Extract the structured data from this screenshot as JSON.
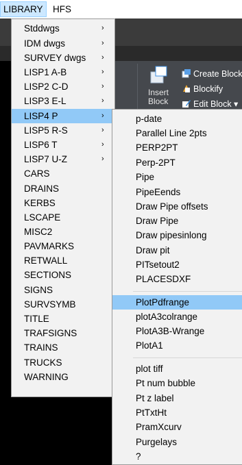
{
  "menubar": {
    "library": "LIBRARY",
    "hfs": "HFS"
  },
  "ribbon": {
    "insert_label_1": "Insert",
    "insert_label_2": "Block",
    "create_block": "Create Block",
    "blockify": "Blockify",
    "edit_block": "Edit Block ▾"
  },
  "library_menu": {
    "items": [
      {
        "label": "Stddwgs",
        "submenu": "›"
      },
      {
        "label": "IDM dwgs",
        "submenu": "›"
      },
      {
        "label": "SURVEY dwgs",
        "submenu": "›"
      },
      {
        "label": "LISP1 A-B",
        "submenu": "›"
      },
      {
        "label": "LISP2 C-D",
        "submenu": "›"
      },
      {
        "label": "LISP3 E-L",
        "submenu": "›"
      },
      {
        "label": "LISP4 P",
        "submenu": "›"
      },
      {
        "label": "LISP5 R-S",
        "submenu": "›"
      },
      {
        "label": "LISP6 T",
        "submenu": "›"
      },
      {
        "label": "LISP7 U-Z",
        "submenu": "›"
      },
      {
        "label": "CARS"
      },
      {
        "label": "DRAINS"
      },
      {
        "label": "KERBS"
      },
      {
        "label": "LSCAPE"
      },
      {
        "label": "MISC2"
      },
      {
        "label": "PAVMARKS"
      },
      {
        "label": "RETWALL"
      },
      {
        "label": "SECTIONS"
      },
      {
        "label": "SIGNS"
      },
      {
        "label": "SURVSYMB"
      },
      {
        "label": "TITLE"
      },
      {
        "label": "TRAFSIGNS"
      },
      {
        "label": "TRAINS"
      },
      {
        "label": "TRUCKS"
      },
      {
        "label": "WARNING"
      }
    ]
  },
  "lisp4_menu": {
    "items": [
      {
        "label": "p-date"
      },
      {
        "label": "Parallel Line 2pts"
      },
      {
        "label": "PERP2PT"
      },
      {
        "label": "Perp-2PT"
      },
      {
        "label": "Pipe"
      },
      {
        "label": "PipeEends"
      },
      {
        "label": "Draw Pipe offsets"
      },
      {
        "label": "Draw Pipe"
      },
      {
        "label": "Draw pipesinlong"
      },
      {
        "label": "Draw pit"
      },
      {
        "label": "PITsetout2"
      },
      {
        "label": "PLACESDXF"
      },
      {
        "label": "PlotPdfrange"
      },
      {
        "label": "plotA3colrange"
      },
      {
        "label": "PlotA3B-Wrange"
      },
      {
        "label": "PlotA1"
      },
      {
        "label": "plot tiff"
      },
      {
        "label": "Pt num bubble"
      },
      {
        "label": "Pt z label"
      },
      {
        "label": "PtTxtHt"
      },
      {
        "label": "PramXcurv"
      },
      {
        "label": "Purgelays"
      },
      {
        "label": "?"
      }
    ]
  }
}
